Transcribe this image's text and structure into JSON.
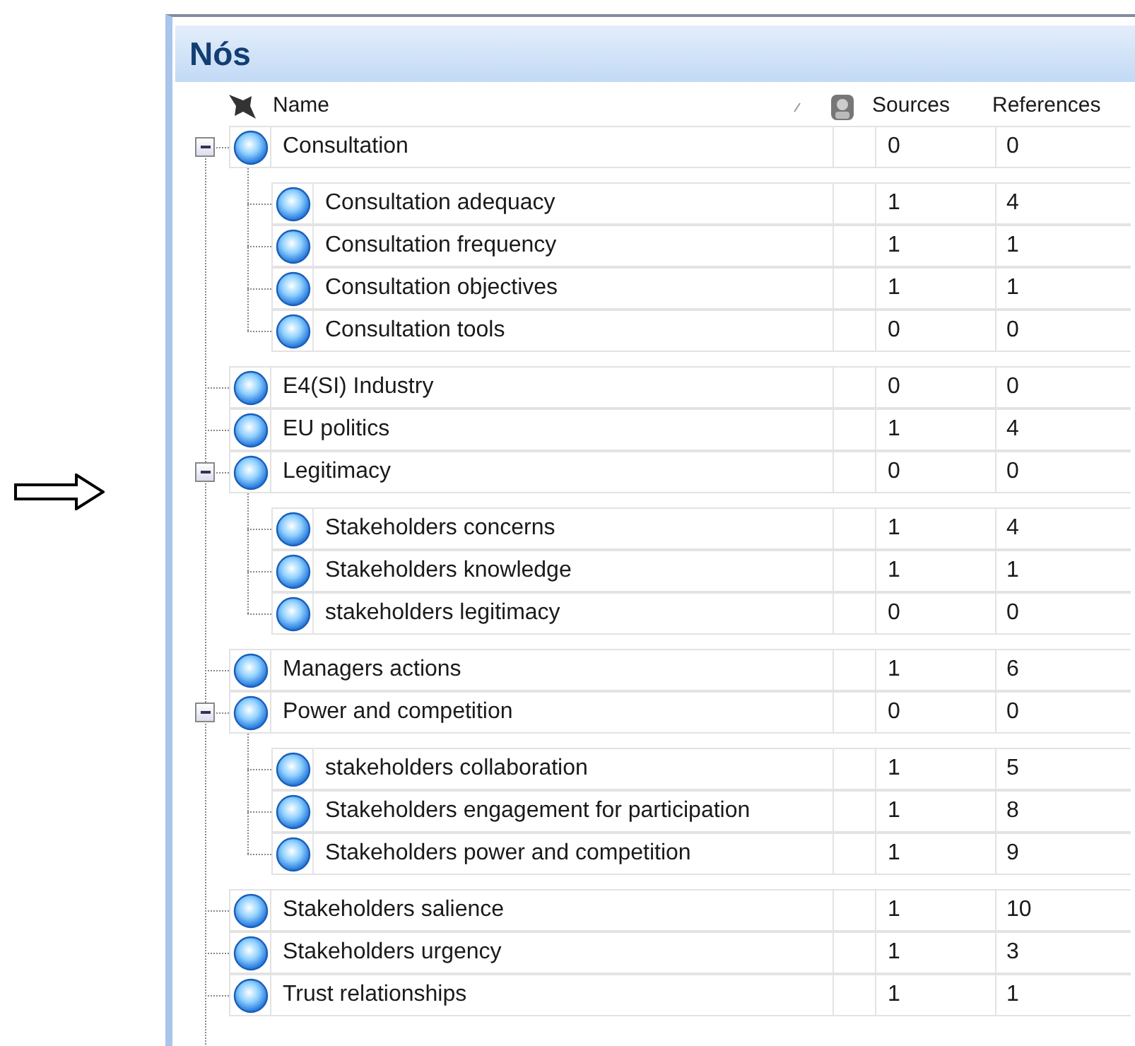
{
  "panel": {
    "title": "Nós"
  },
  "columns": {
    "name": "Name",
    "sources": "Sources",
    "references": "References"
  },
  "nodes": [
    {
      "name": "Consultation",
      "sources": "0",
      "references": "0",
      "expanded": true,
      "children": [
        {
          "name": "Consultation adequacy",
          "sources": "1",
          "references": "4"
        },
        {
          "name": "Consultation frequency",
          "sources": "1",
          "references": "1"
        },
        {
          "name": "Consultation objectives",
          "sources": "1",
          "references": "1"
        },
        {
          "name": "Consultation tools",
          "sources": "0",
          "references": "0"
        }
      ]
    },
    {
      "name": "E4(SI) Industry",
      "sources": "0",
      "references": "0"
    },
    {
      "name": "EU politics",
      "sources": "1",
      "references": "4"
    },
    {
      "name": "Legitimacy",
      "sources": "0",
      "references": "0",
      "expanded": true,
      "children": [
        {
          "name": "Stakeholders concerns",
          "sources": "1",
          "references": "4"
        },
        {
          "name": "Stakeholders knowledge",
          "sources": "1",
          "references": "1"
        },
        {
          "name": "stakeholders legitimacy",
          "sources": "0",
          "references": "0"
        }
      ]
    },
    {
      "name": "Managers actions",
      "sources": "1",
      "references": "6"
    },
    {
      "name": "Power and competition",
      "sources": "0",
      "references": "0",
      "expanded": true,
      "children": [
        {
          "name": "stakeholders collaboration",
          "sources": "1",
          "references": "5"
        },
        {
          "name": "Stakeholders engagement for participation",
          "sources": "1",
          "references": "8"
        },
        {
          "name": "Stakeholders power and competition",
          "sources": "1",
          "references": "9"
        }
      ]
    },
    {
      "name": "Stakeholders salience",
      "sources": "1",
      "references": "10"
    },
    {
      "name": "Stakeholders urgency",
      "sources": "1",
      "references": "3"
    },
    {
      "name": "Trust relationships",
      "sources": "1",
      "references": "1"
    }
  ]
}
